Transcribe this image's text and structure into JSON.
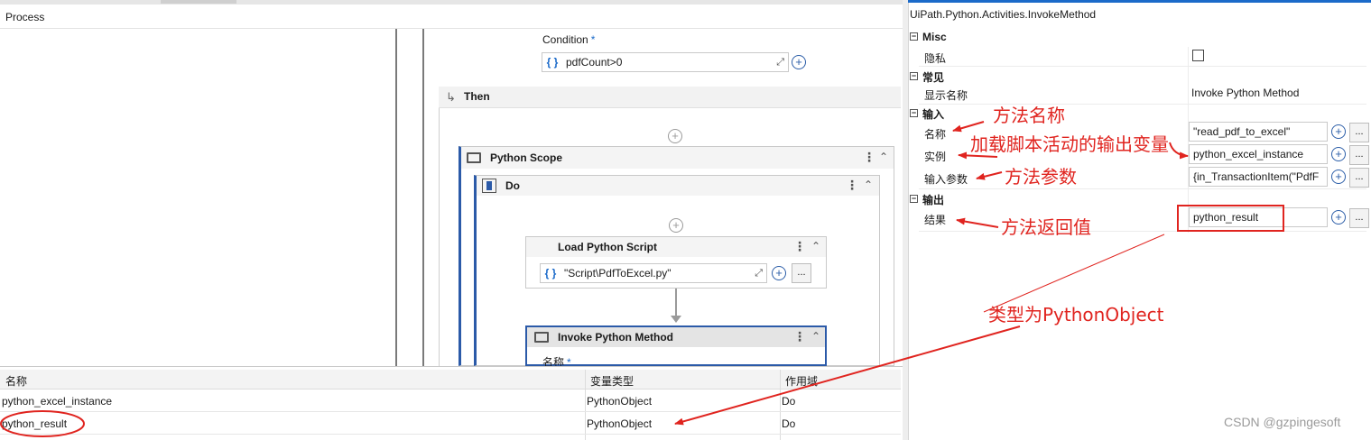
{
  "breadcrumb": "Process",
  "designer": {
    "condition_label": "Condition",
    "required_mark": "*",
    "condition_value": "pdfCount>0",
    "then_label": "Then",
    "python_scope_title": "Python Scope",
    "do_title": "Do",
    "load_script_title": "Load Python Script",
    "load_script_value": "\"Script\\PdfToExcel.py\"",
    "invoke_method_title": "Invoke Python Method",
    "invoke_name_label": "名称",
    "braces": "{ }",
    "ellipsis": "...",
    "plus": "+"
  },
  "variables": {
    "headers": [
      "名称",
      "变量类型",
      "作用域"
    ],
    "rows": [
      {
        "name": "python_excel_instance",
        "type": "PythonObject",
        "scope": "Do"
      },
      {
        "name": "python_result",
        "type": "PythonObject",
        "scope": "Do"
      }
    ]
  },
  "properties": {
    "title": "UiPath.Python.Activities.InvokeMethod",
    "categories": {
      "misc": "Misc",
      "common": "常见",
      "input": "输入",
      "output": "输出"
    },
    "misc_private_label": "隐私",
    "display_name_label": "显示名称",
    "display_name_value": "Invoke Python Method",
    "name_label": "名称",
    "name_value": "\"read_pdf_to_excel\"",
    "instance_label": "实例",
    "instance_value": "python_excel_instance",
    "params_label": "输入参数",
    "params_value": "{in_TransactionItem(\"PdfF",
    "result_label": "结果",
    "result_value": "python_result",
    "collapse_glyph": "⊟"
  },
  "annotations": {
    "method_name": "方法名称",
    "load_output": "加载脚本活动的输出变量",
    "method_params": "方法参数",
    "method_return": "方法返回值",
    "type_note": "类型为PythonObject"
  },
  "watermark": "CSDN @gzpingesoft",
  "colors": {
    "accent": "#1b6ac9",
    "annotation_red": "#e0241f",
    "scope_border": "#2b5aa8"
  }
}
